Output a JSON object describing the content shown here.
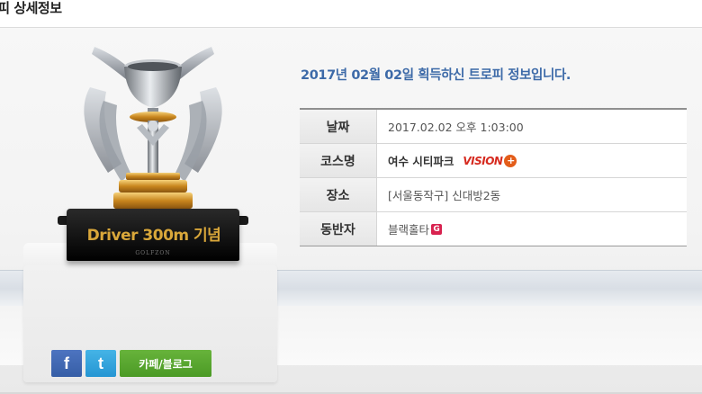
{
  "header": {
    "title": "로피 상세정보"
  },
  "trophy": {
    "plaque_text": "Driver 300m 기념",
    "plaque_logo": "GOLFZON"
  },
  "info": {
    "title": "2017년 02월 02일 획득하신 트로피 정보입니다.",
    "rows": [
      {
        "label": "날짜",
        "value": "2017.02.02 오후 1:03:00"
      },
      {
        "label": "코스명",
        "value": "여수 시티파크",
        "logo": "VISION"
      },
      {
        "label": "장소",
        "value": "[서울동작구] 신대방2동"
      },
      {
        "label": "동반자",
        "value": "블랙홀타",
        "badge": "G"
      }
    ]
  },
  "share": {
    "facebook_label": "f",
    "twitter_label": "t",
    "cafe_blog_label": "카페/블로그"
  },
  "colors": {
    "title_blue": "#3d6aa8",
    "facebook": "#3b5998",
    "twitter": "#2aa9e0",
    "cafe_green": "#5aa82f",
    "plaque_gold": "#d9a73a"
  }
}
